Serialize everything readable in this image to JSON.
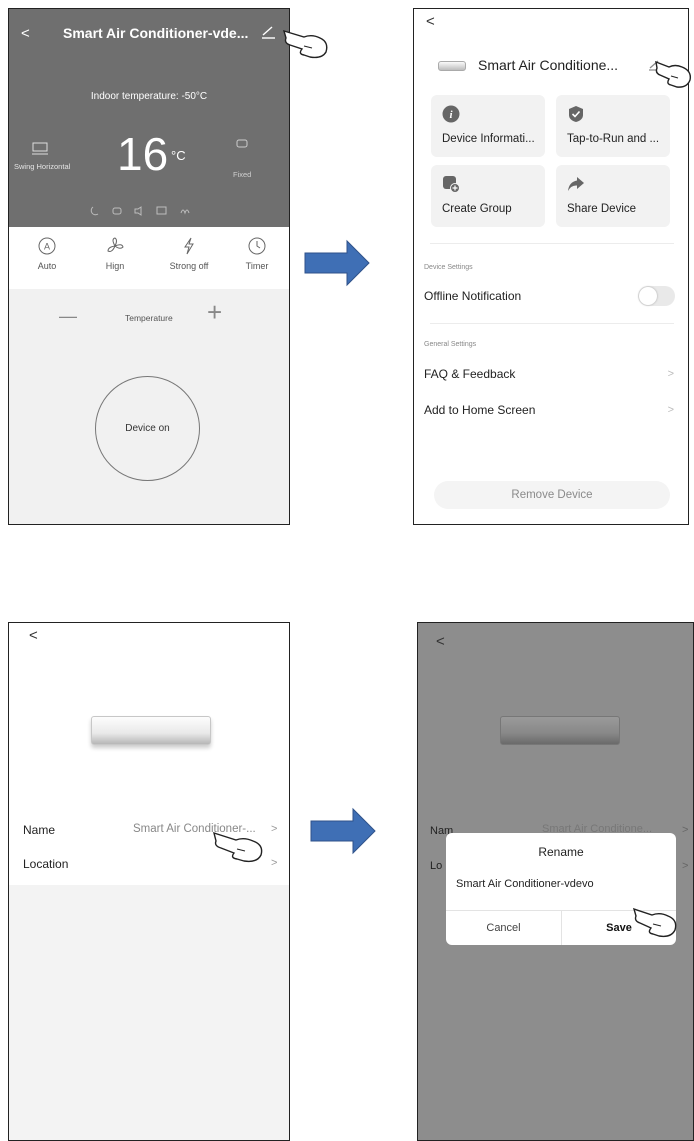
{
  "panel1": {
    "back_icon": "chevron-left-icon",
    "title": "Smart Air Conditioner-vde...",
    "edit_icon": "pencil-icon",
    "indoor_temp": "Indoor temperature: -50°C",
    "swing_label": "Swing Horizontal",
    "temp_value": "16",
    "temp_unit": "°C",
    "fixed_label": "Fixed",
    "controls": [
      {
        "icon": "auto-mode-icon",
        "label": "Auto"
      },
      {
        "icon": "fan-icon",
        "label": "Hign"
      },
      {
        "icon": "lightning-icon",
        "label": "Strong off"
      },
      {
        "icon": "clock-icon",
        "label": "Timer"
      }
    ],
    "minus": "—",
    "temperature_label": "Temperature",
    "plus": "+",
    "power_label": "Device on"
  },
  "panel2": {
    "back": "<",
    "title": "Smart Air Conditione...",
    "cards": [
      {
        "icon": "info-icon",
        "label": "Device Informati..."
      },
      {
        "icon": "check-shield-icon",
        "label": "Tap-to-Run and ..."
      },
      {
        "icon": "add-group-icon",
        "label": "Create Group"
      },
      {
        "icon": "share-icon",
        "label": "Share Device"
      }
    ],
    "device_settings_header": "Device Settings",
    "offline_notification": "Offline Notification",
    "general_settings_header": "General Settings",
    "faq": "FAQ & Feedback",
    "add_home": "Add to Home Screen",
    "chevron": ">",
    "remove_device": "Remove Device"
  },
  "panel3": {
    "back": "<",
    "name_label": "Name",
    "name_value": "Smart Air Conditioner-...",
    "location_label": "Location",
    "chevron": ">"
  },
  "panel4": {
    "back": "<",
    "name_label_partial": "Nam",
    "name_value_partial": "Smart Air Conditione...",
    "location_label_partial": "Lo",
    "chevron": ">",
    "dialog_title": "Rename",
    "dialog_value": "Smart Air Conditioner-vdevo",
    "cancel": "Cancel",
    "save": "Save"
  },
  "colors": {
    "dark_header": "#6f6f6f",
    "arrow_blue": "#3f6fb5",
    "overlay_gray": "#8d8d8d"
  }
}
